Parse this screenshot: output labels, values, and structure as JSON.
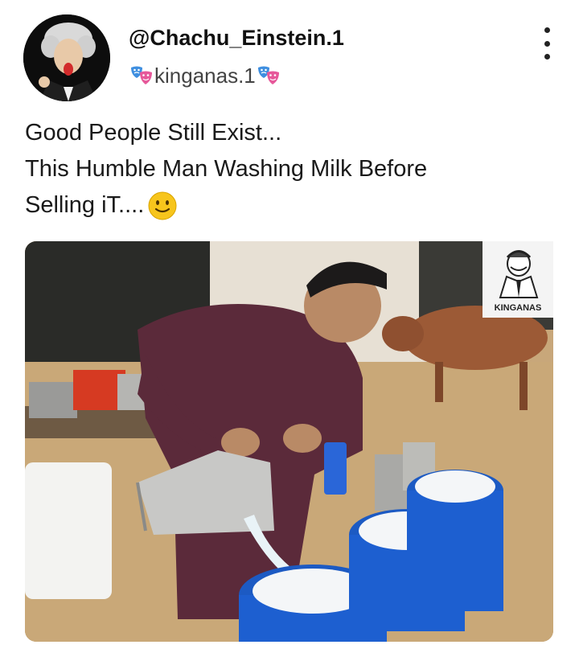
{
  "post": {
    "author_handle": "@Chachu_Einstein.1",
    "sub_name": "kinganas.1",
    "caption_lines": [
      "Good People Still Exist...",
      "This Humble Man Washing Milk Before",
      "Selling iT...."
    ],
    "icons": {
      "avatar": "avatar-caricature",
      "mask": "theater-masks-icon",
      "menu": "more-vertical-icon",
      "emoji": "slightly-smiling-face-emoji"
    },
    "watermark_text": "KINGANAS"
  },
  "colors": {
    "text": "#1a1a1a",
    "muted": "#444444",
    "background": "#ffffff",
    "emoji_yellow": "#f7c51c"
  }
}
